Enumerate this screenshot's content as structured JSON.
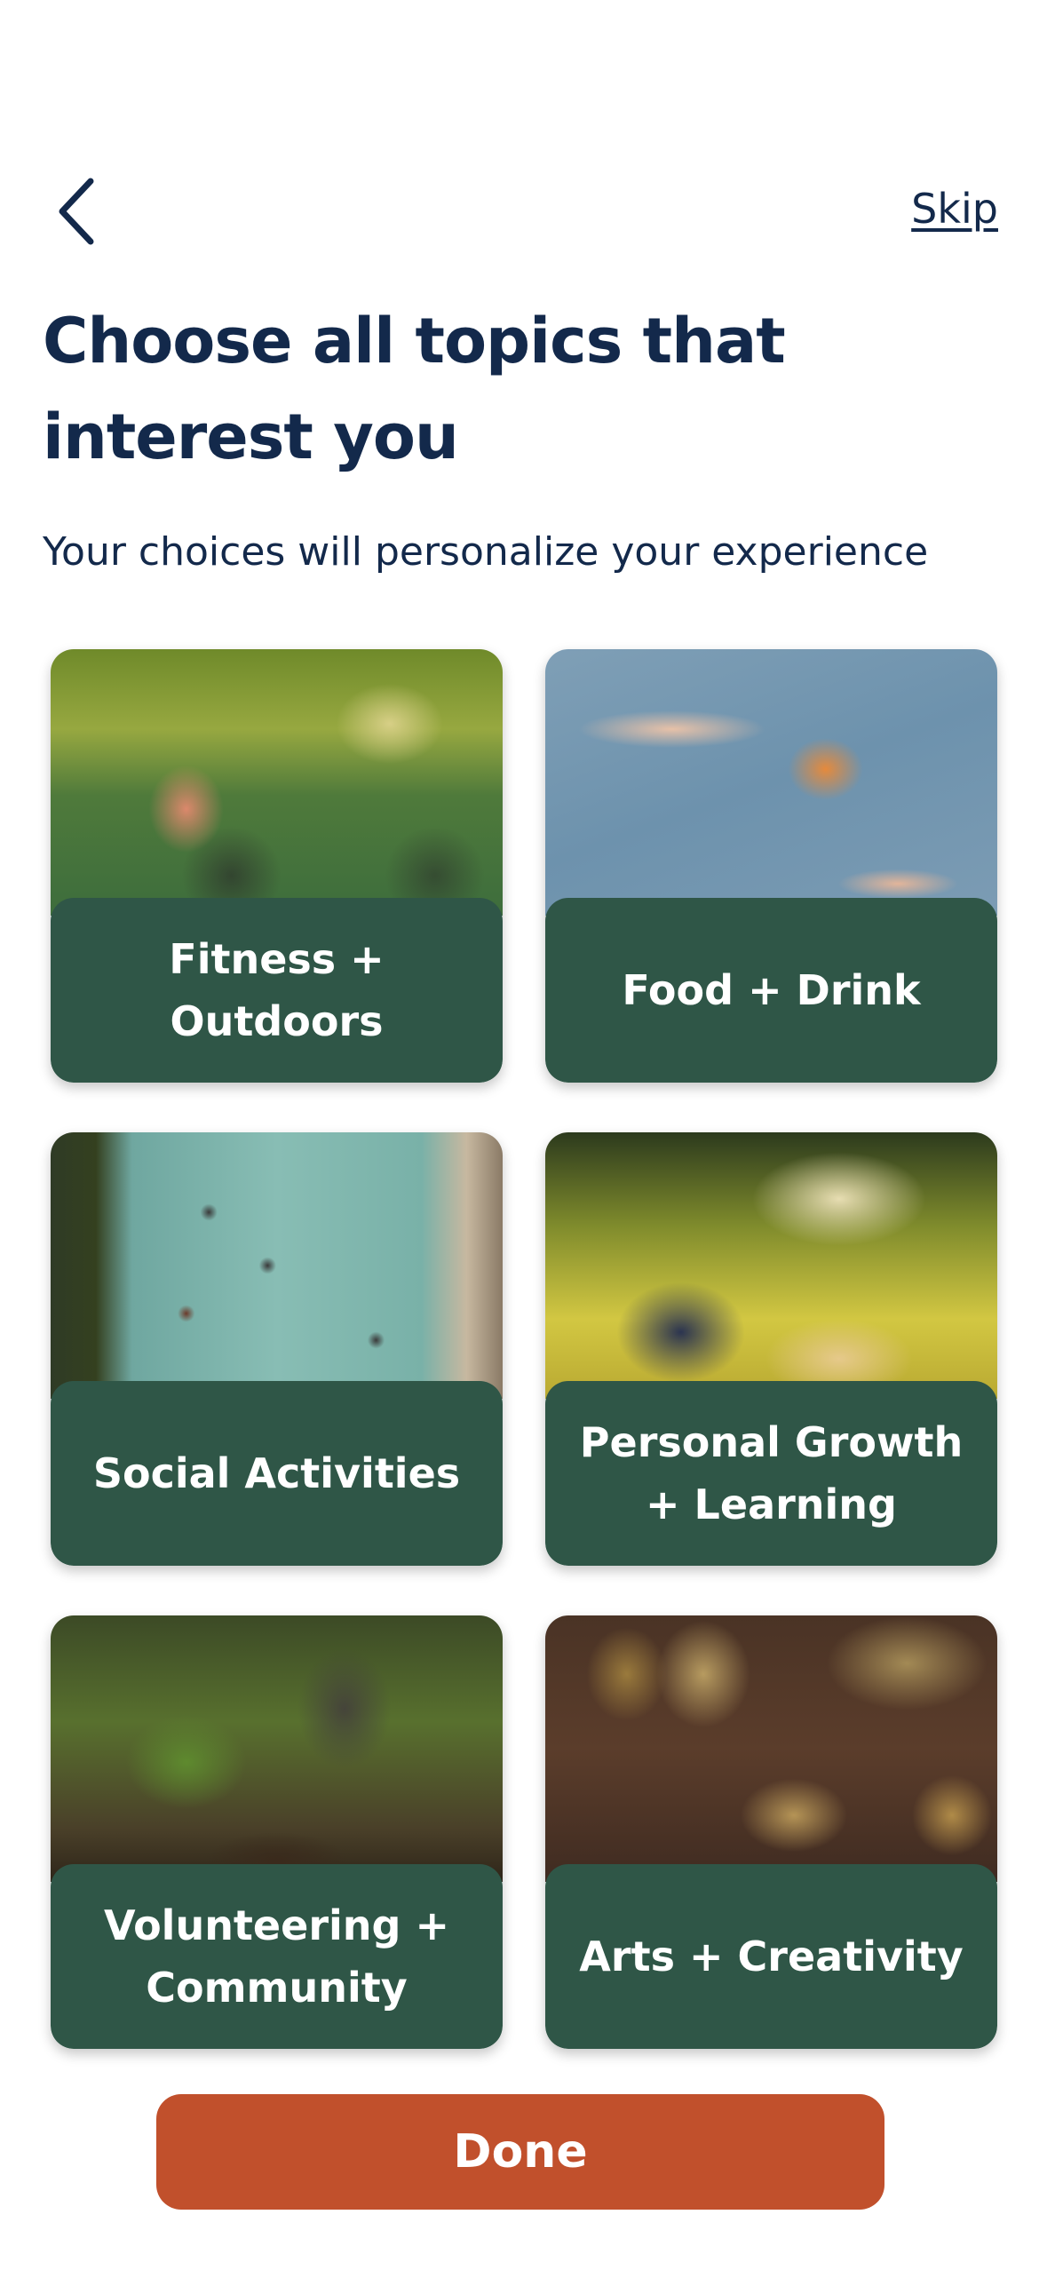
{
  "header": {
    "back_icon": "chevron-left-icon",
    "skip_label": "Skip"
  },
  "title": "Choose all topics that interest you",
  "subtitle": "Your choices will personalize your experience",
  "topics": [
    {
      "label": "Fitness + Outdoors"
    },
    {
      "label": "Food + Drink"
    },
    {
      "label": "Social Activities"
    },
    {
      "label": "Personal Growth + Learning"
    },
    {
      "label": "Volunteering + Community"
    },
    {
      "label": "Arts + Creativity"
    }
  ],
  "done_label": "Done",
  "colors": {
    "text": "#13294b",
    "card_label_bg": "#2f5647",
    "done_button": "#c1502c"
  }
}
